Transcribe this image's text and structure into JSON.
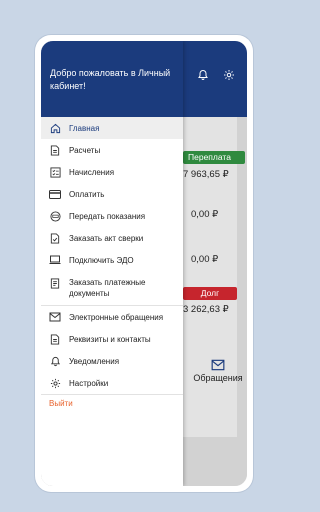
{
  "background": {
    "badge_overpay": "Переплата",
    "amount_1": "7 963,65 ₽",
    "amount_2": "0,00 ₽",
    "amount_3": "0,00 ₽",
    "badge_debt": "Долг",
    "amount_4": "3 262,63 ₽",
    "appeals_label": "Обращения",
    "icons": [
      "bell-icon",
      "gear-icon",
      "mail-icon"
    ]
  },
  "drawer": {
    "welcome": "Добро пожаловать в Личный кабинет!",
    "menu_group_1": [
      {
        "label": "Главная",
        "icon": "home-icon",
        "active": true
      },
      {
        "label": "Расчеты",
        "icon": "document-icon"
      },
      {
        "label": "Начисления",
        "icon": "checklist-icon"
      },
      {
        "label": "Оплатить",
        "icon": "card-icon"
      },
      {
        "label": "Передать показания",
        "icon": "meter-icon"
      },
      {
        "label": "Заказать акт сверки",
        "icon": "document-check-icon"
      },
      {
        "label": "Подключить ЭДО",
        "icon": "laptop-icon"
      },
      {
        "label": "Заказать платежные документы",
        "icon": "document-lines-icon"
      }
    ],
    "menu_group_2": [
      {
        "label": "Электронные обращения",
        "icon": "mail-icon"
      },
      {
        "label": "Реквизиты и контакты",
        "icon": "document-icon"
      },
      {
        "label": "Уведомления",
        "icon": "bell-icon"
      },
      {
        "label": "Настройки",
        "icon": "gear-icon"
      }
    ],
    "logout": "Выйти"
  },
  "colors": {
    "brand": "#1b3b7d",
    "overpay": "#2f8a3f",
    "debt": "#c6252d",
    "logout": "#e8622c"
  }
}
